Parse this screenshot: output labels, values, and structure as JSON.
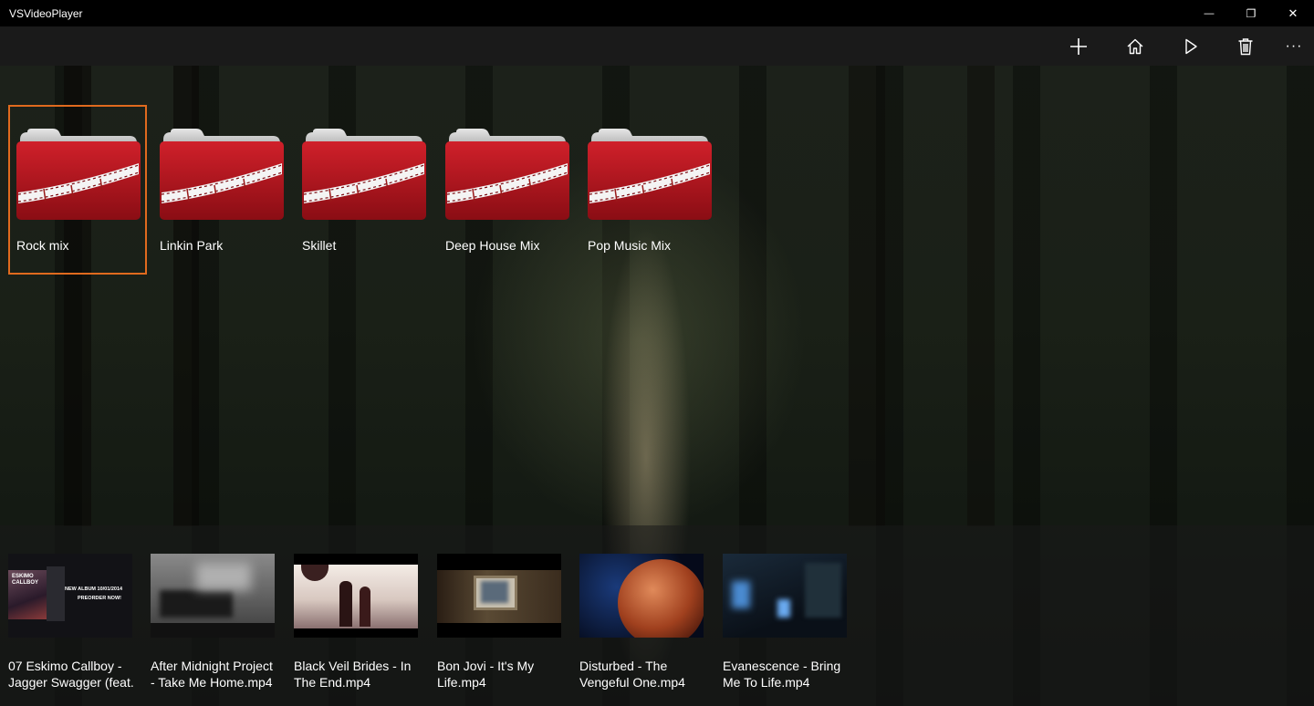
{
  "app": {
    "title": "VSVideoPlayer"
  },
  "window_controls": {
    "minimize_glyph": "—",
    "restore_glyph": "❐",
    "close_glyph": "✕"
  },
  "commands": [
    {
      "name": "add",
      "icon": "plus-icon"
    },
    {
      "name": "home",
      "icon": "home-icon"
    },
    {
      "name": "play",
      "icon": "play-icon"
    },
    {
      "name": "delete",
      "icon": "trash-icon"
    },
    {
      "name": "more",
      "icon": "more-icon",
      "glyph": "···"
    }
  ],
  "folders": [
    {
      "label": "Rock mix",
      "selected": true
    },
    {
      "label": "Linkin Park",
      "selected": false
    },
    {
      "label": "Skillet",
      "selected": false
    },
    {
      "label": "Deep House Mix",
      "selected": false
    },
    {
      "label": "Pop Music Mix",
      "selected": false
    }
  ],
  "videos": [
    {
      "line1": "07 Eskimo Callboy -",
      "line2": "Jagger Swagger (feat.",
      "thumb_text1": "ESKIMO CALLBOY",
      "thumb_text2": "NEW ALBUM 10/01/2014",
      "thumb_text3": "PREORDER NOW!"
    },
    {
      "line1": "After Midnight Project",
      "line2": "- Take Me Home.mp4"
    },
    {
      "line1": "Black Veil Brides - In",
      "line2": "The End.mp4"
    },
    {
      "line1": "Bon Jovi - It's My",
      "line2": "Life.mp4"
    },
    {
      "line1": "Disturbed - The",
      "line2": "Vengeful One.mp4"
    },
    {
      "line1": "Evanescence - Bring",
      "line2": "Me To Life.mp4"
    }
  ],
  "colors": {
    "accent_selection": "#e06a1e",
    "folder_red": "#b3121c",
    "titlebar": "#000000",
    "commandbar": "#1a1a1a"
  }
}
